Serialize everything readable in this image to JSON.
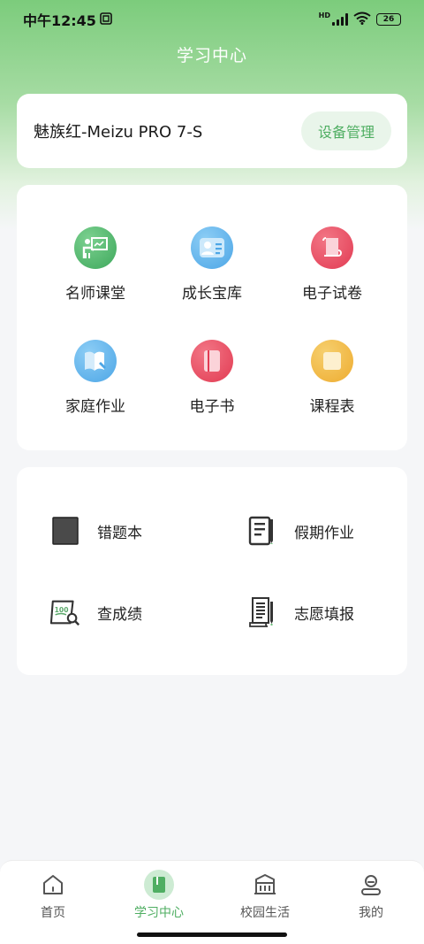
{
  "status_bar": {
    "time": "中午12:45",
    "battery": "26",
    "network": "HD"
  },
  "header": {
    "title": "学习中心"
  },
  "device": {
    "name": "魅族红-Meizu PRO 7-S",
    "manage_label": "设备管理"
  },
  "grid": [
    {
      "label": "名师课堂",
      "icon": "teacher-icon",
      "color": "#52b66f"
    },
    {
      "label": "成长宝库",
      "icon": "profile-card-icon",
      "color": "#5aaee8"
    },
    {
      "label": "电子试卷",
      "icon": "scroll-paper-icon",
      "color": "#e8485e"
    },
    {
      "label": "家庭作业",
      "icon": "book-pencil-icon",
      "color": "#5aaee8"
    },
    {
      "label": "电子书",
      "icon": "ebook-icon",
      "color": "#e8485e"
    },
    {
      "label": "课程表",
      "icon": "schedule-icon",
      "color": "#f0b43c"
    }
  ],
  "list": [
    {
      "label": "错题本",
      "icon": "notebook-icon"
    },
    {
      "label": "假期作业",
      "icon": "document-pen-icon"
    },
    {
      "label": "查成绩",
      "icon": "score-search-icon",
      "badge": "100"
    },
    {
      "label": "志愿填报",
      "icon": "scroll-pen-icon"
    }
  ],
  "tabs": [
    {
      "label": "首页",
      "icon": "home-icon"
    },
    {
      "label": "学习中心",
      "icon": "study-icon"
    },
    {
      "label": "校园生活",
      "icon": "school-icon"
    },
    {
      "label": "我的",
      "icon": "user-icon"
    }
  ],
  "colors": {
    "accent": "#4fae62",
    "header_green": "#7ccc7c"
  }
}
